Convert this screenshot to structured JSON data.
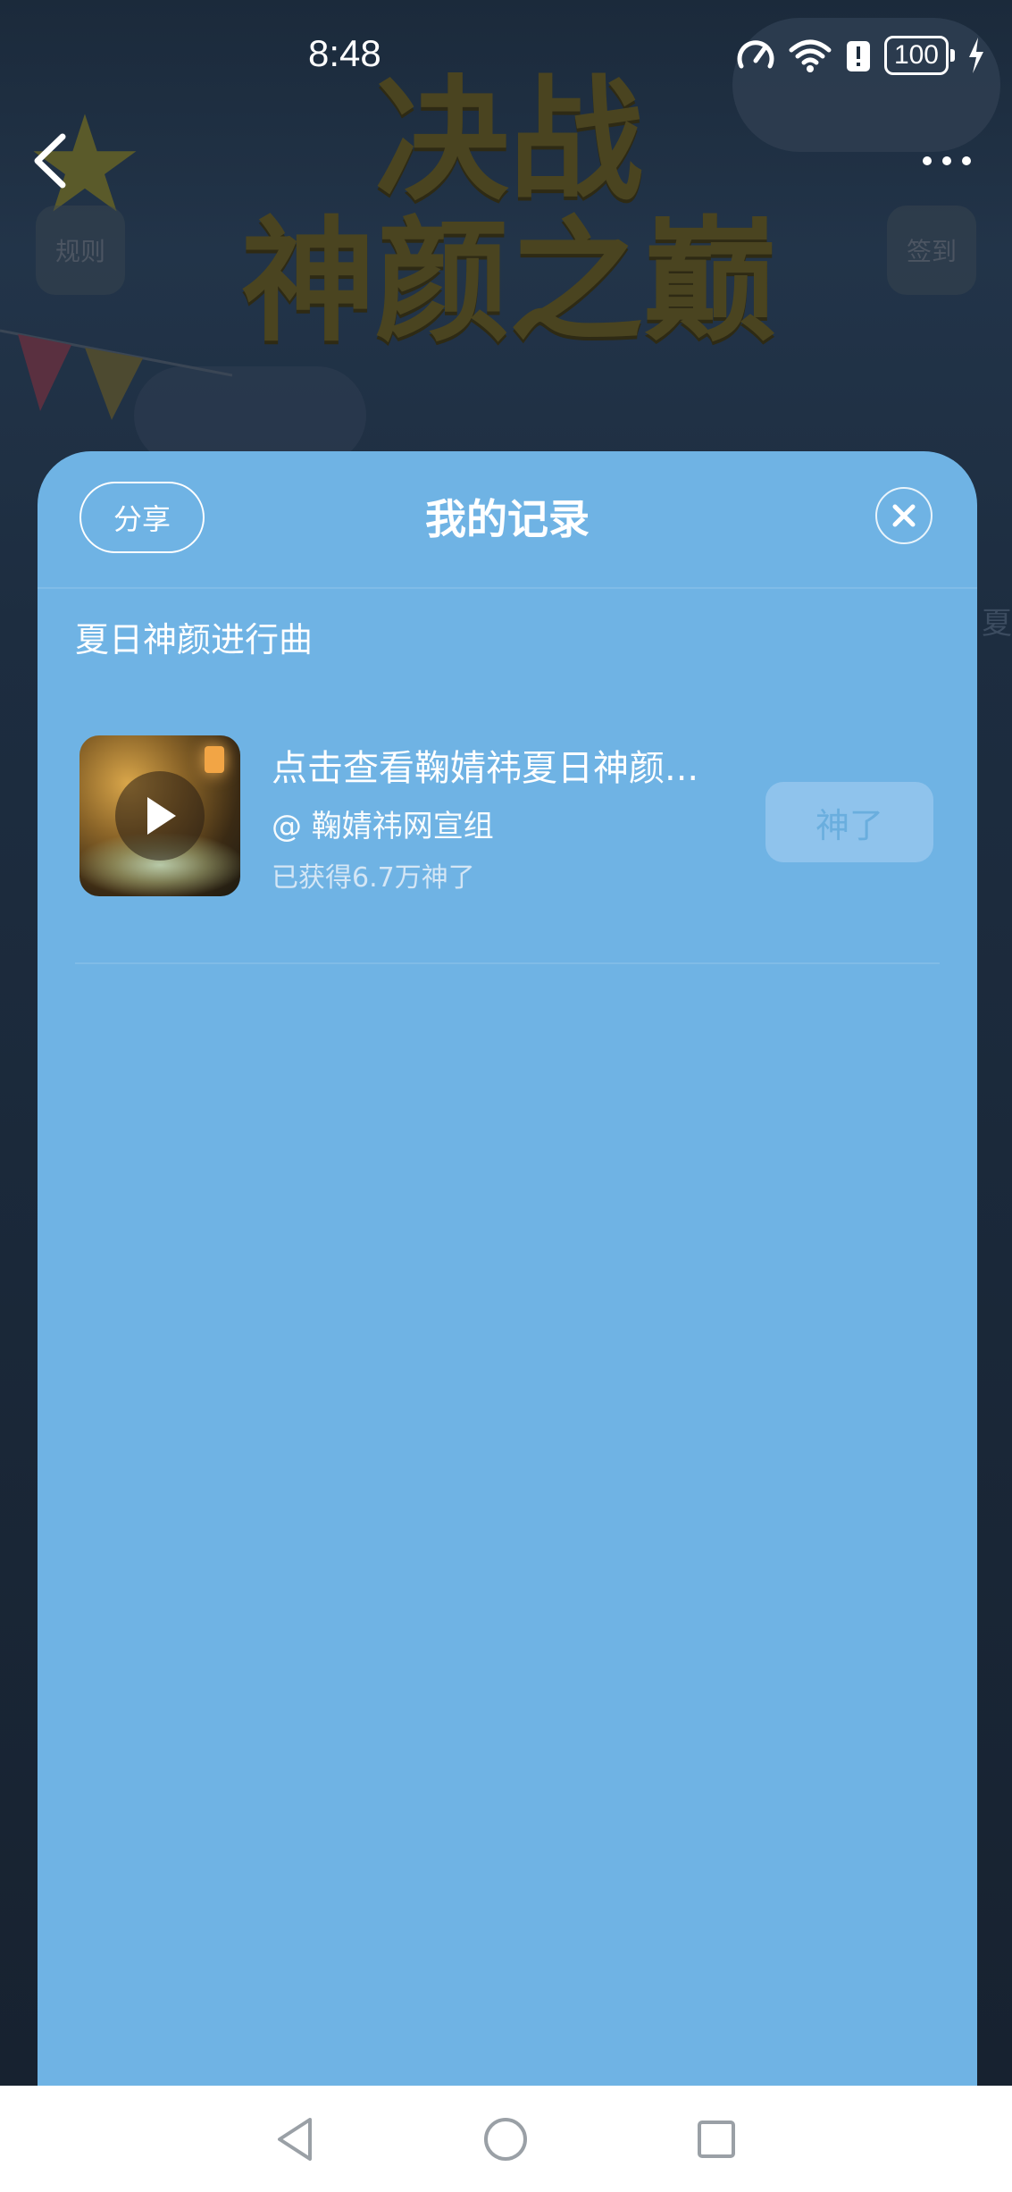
{
  "status_bar": {
    "time": "8:48",
    "battery": "100"
  },
  "background": {
    "title_line1": "决战",
    "title_line2": "神颜之巅",
    "rules_label": "规则",
    "checkin_label": "签到",
    "side_text": "夏"
  },
  "modal": {
    "share_label": "分享",
    "title": "我的记录",
    "section_title": "夏日神颜进行曲",
    "items": [
      {
        "title": "点击查看鞠婧祎夏日神颜...",
        "author": "@ 鞠婧祎网宣组",
        "stats": "已获得6.7万神了",
        "action_label": "神了"
      }
    ]
  },
  "colors": {
    "card_bg": "#6fb3e4",
    "action_bg": "#8fc3ec",
    "action_text": "#6aaede"
  }
}
